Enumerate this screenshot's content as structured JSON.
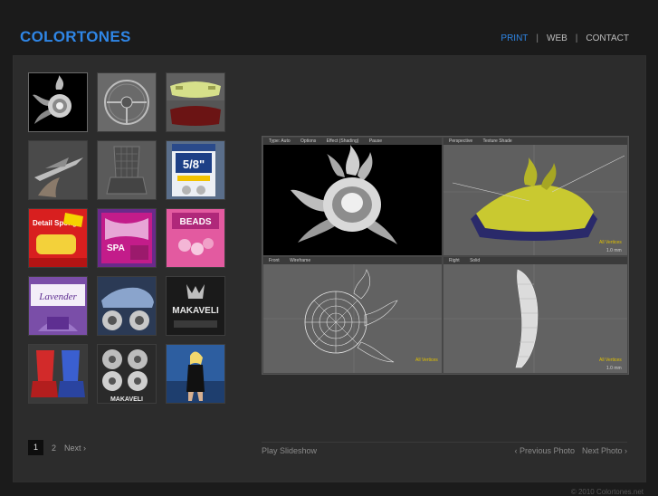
{
  "brand": {
    "name": "COLORTONES"
  },
  "nav": {
    "items": [
      "PRINT",
      "WEB",
      "CONTACT"
    ],
    "separator": "|"
  },
  "thumbnails": [
    {
      "subject": "flaming-wheel-render-icon"
    },
    {
      "subject": "steering-wheel-icon"
    },
    {
      "subject": "car-bumper-icon"
    },
    {
      "subject": "ornament-icon"
    },
    {
      "subject": "car-seat-wireframe-icon"
    },
    {
      "subject": "socket-package-icon",
      "text": "5/8\""
    },
    {
      "subject": "detail-sponge-package-icon",
      "text": "Detail Sponge"
    },
    {
      "subject": "polishing-towel-package-icon",
      "text": "SPA"
    },
    {
      "subject": "beads-package-icon",
      "text": "BEADS"
    },
    {
      "subject": "lavender-package-icon",
      "text": "Lavender"
    },
    {
      "subject": "car-wheels-icon"
    },
    {
      "subject": "makaveli-logo-icon",
      "text": "MAKAVELI"
    },
    {
      "subject": "seat-covers-icon"
    },
    {
      "subject": "makaveli-wheels-icon",
      "text": "MAKAVELI"
    },
    {
      "subject": "model-photo-icon"
    }
  ],
  "pager": {
    "pages": [
      "1",
      "2"
    ],
    "current": "1",
    "next_label": "Next ›"
  },
  "viewer": {
    "top_left_bar": [
      "Type: Auto",
      "Options",
      "Effect (Shading)",
      "Pause"
    ],
    "top_right_bar": [
      "Perspective",
      "Texture Shade"
    ],
    "bottom_left_bar": [
      "Front",
      "Wireframe"
    ],
    "bottom_right_bar": [
      "Right",
      "Solid"
    ],
    "vertex_tag": "All Vertices",
    "scale_label": "1.0 mm"
  },
  "controls": {
    "play_label": "Play Slideshow",
    "prev_label": "‹ Previous Photo",
    "next_label": "Next Photo ›"
  },
  "footer": {
    "copyright": "© 2010 Colortones.net"
  },
  "colors": {
    "accent": "#2f86e6",
    "background": "#1b1b1b",
    "panel": "#2c2c2c",
    "wire": "#e0c000"
  }
}
